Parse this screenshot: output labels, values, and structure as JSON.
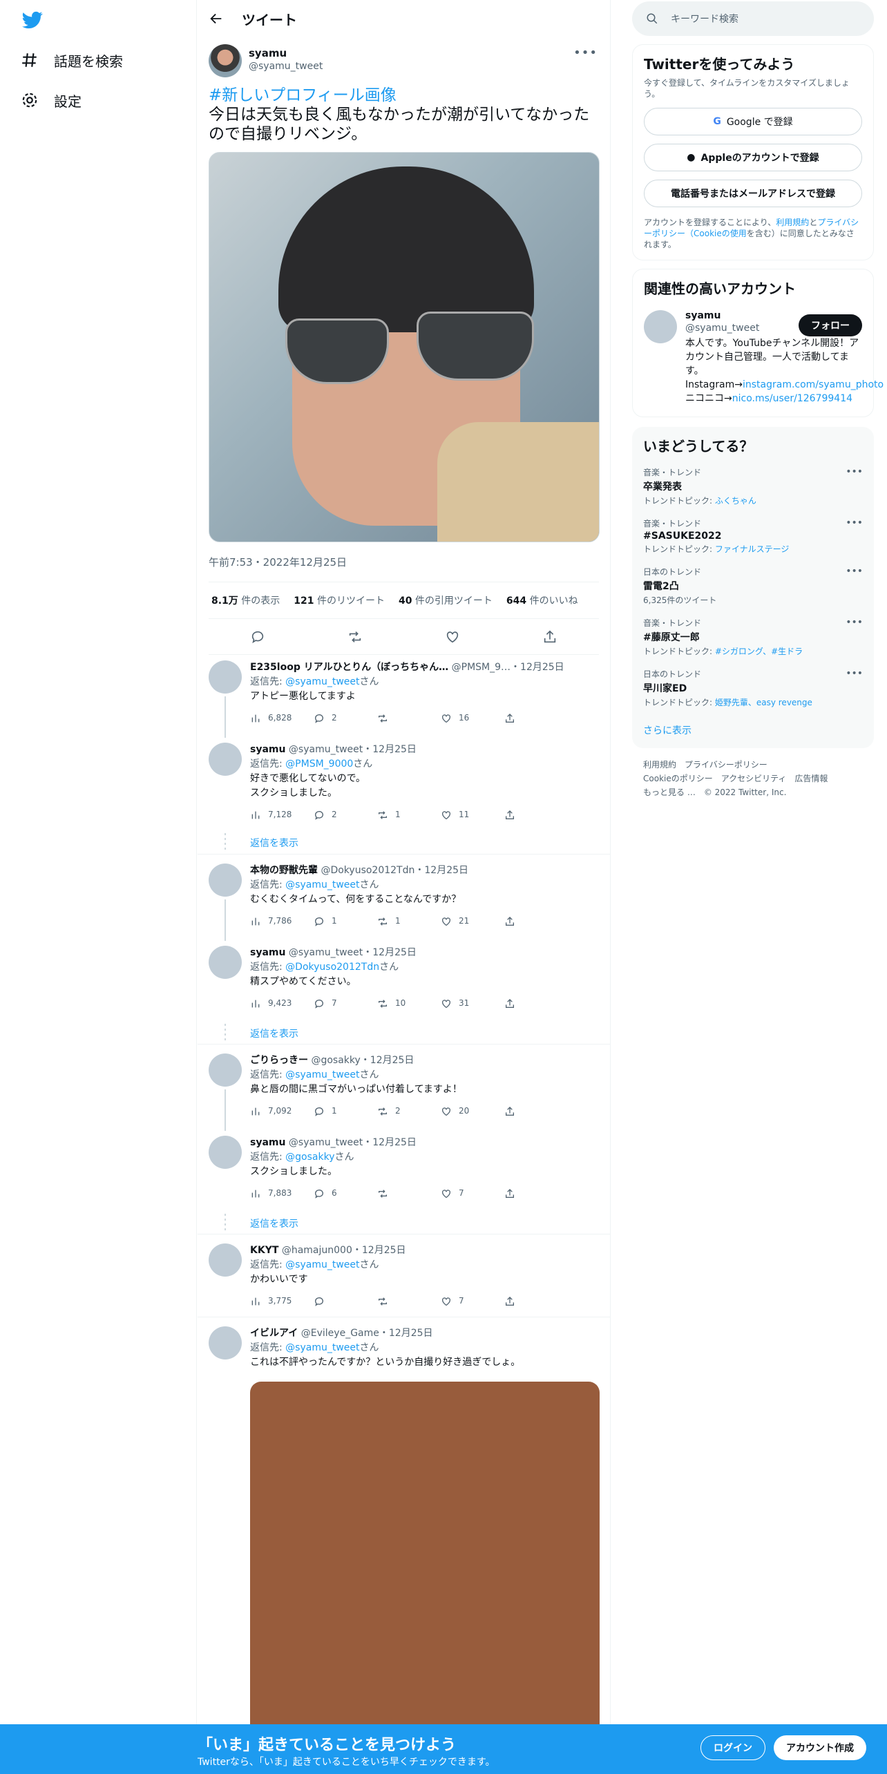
{
  "nav": {
    "items": [
      {
        "label": "話題を検索",
        "icon": "hashtag-icon"
      },
      {
        "label": "設定",
        "icon": "gear-icon"
      }
    ]
  },
  "header": {
    "title": "ツイート"
  },
  "tweet": {
    "name": "syamu",
    "handle": "@syamu_tweet",
    "hashtag": "#新しいプロフィール画像",
    "text": "今日は天気も良く風もなかったが潮が引いてなかったので自撮りリベンジ。",
    "time": "午前7:53・2022年12月25日",
    "stats": [
      {
        "num": "8.1万",
        "label": "件の表示"
      },
      {
        "num": "121",
        "label": "件のリツイート"
      },
      {
        "num": "40",
        "label": "件の引用ツイート"
      },
      {
        "num": "644",
        "label": "件のいいね"
      }
    ]
  },
  "replies": [
    {
      "name": "E235loop リアルひとりん（ぼっちちゃん…",
      "handle": "@PMSM_9…",
      "date": "・12月25日",
      "reply_to": "@syamu_tweet",
      "text": "アトピー悪化してますよ",
      "views": "6,828",
      "replies": "2",
      "retweets": "",
      "likes": "16"
    },
    {
      "name": "syamu",
      "handle": "@syamu_tweet",
      "date": "・12月25日",
      "reply_to": "@PMSM_9000",
      "text": "好きで悪化してないので。\nスクショしました。",
      "views": "7,128",
      "replies": "2",
      "retweets": "1",
      "likes": "11"
    },
    {
      "name": "本物の野獣先輩",
      "handle": "@Dokyuso2012Tdn",
      "date": "・12月25日",
      "reply_to": "@syamu_tweet",
      "text": "むくむくタイムって、何をすることなんですか？",
      "views": "7,786",
      "replies": "1",
      "retweets": "1",
      "likes": "21"
    },
    {
      "name": "syamu",
      "handle": "@syamu_tweet",
      "date": "・12月25日",
      "reply_to": "@Dokyuso2012Tdn",
      "text": "精スプやめてください。",
      "views": "9,423",
      "replies": "7",
      "retweets": "10",
      "likes": "31"
    },
    {
      "name": "ごりらっきー",
      "handle": "@gosakky",
      "date": "・12月25日",
      "reply_to": "@syamu_tweet",
      "text": "鼻と唇の間に黒ゴマがいっぱい付着してますよ！",
      "views": "7,092",
      "replies": "1",
      "retweets": "2",
      "likes": "20"
    },
    {
      "name": "syamu",
      "handle": "@syamu_tweet",
      "date": "・12月25日",
      "reply_to": "@gosakky",
      "text": "スクショしました。",
      "views": "7,883",
      "replies": "6",
      "retweets": "",
      "likes": "7"
    },
    {
      "name": "KKYT",
      "handle": "@hamajun000",
      "date": "・12月25日",
      "reply_to": "@syamu_tweet",
      "text": "かわいいです",
      "views": "3,775",
      "replies": "",
      "retweets": "",
      "likes": "7"
    },
    {
      "name": "イビルアイ",
      "handle": "@Evileye_Game",
      "date": "・12月25日",
      "reply_to": "@syamu_tweet",
      "text": "これは不評やったんですか？というか自撮り好き過ぎでしょ。",
      "views": "",
      "replies": "",
      "retweets": "",
      "likes": ""
    }
  ],
  "reply_prefix": "返信先: ",
  "reply_suffix": "さん",
  "show_replies": "返信を表示",
  "right": {
    "search_placeholder": "キーワード検索",
    "signup_title": "Twitterを使ってみよう",
    "signup_sub": "今すぐ登録して、タイムラインをカスタマイズしましょう。",
    "google": "Google で登録",
    "apple": "Appleのアカウントで登録",
    "phone": "電話番号またはメールアドレスで登録",
    "terms_1": "アカウントを登録することにより、",
    "terms_link1": "利用規約",
    "terms_2": "と",
    "terms_link2": "プライバシーポリシー（Cookieの使用",
    "terms_3": "を含む）に同意したとみなされます。",
    "related_title": "関連性の高いアカウント",
    "related_name": "syamu",
    "related_handle": "@syamu_tweet",
    "follow": "フォロー",
    "related_bio": "本人です。YouTubeチャンネル開設！アカウント自己管理。一人で活動してます。 Instagram→",
    "related_link1": "instagram.com/syamu_photo",
    "related_bio2": " ニコニコ→",
    "related_link2": "nico.ms/user/126799414",
    "trends_title": "いまどうしてる？",
    "trends": [
      {
        "cat": "音楽・トレンド",
        "name": "卒業発表",
        "topic_label": "トレンドトピック: ",
        "topic": "ふくちゃん"
      },
      {
        "cat": "音楽・トレンド",
        "name": "#SASUKE2022",
        "topic_label": "トレンドトピック: ",
        "topic": "ファイナルステージ"
      },
      {
        "cat": "日本のトレンド",
        "name": "雷電2凸",
        "topic_label": "6,325件のツイート",
        "topic": ""
      },
      {
        "cat": "音楽・トレンド",
        "name": "#藤原丈一郎",
        "topic_label": "トレンドトピック: ",
        "topic": "#シガロング、#生ドラ"
      },
      {
        "cat": "日本のトレンド",
        "name": "早川家ED",
        "topic_label": "トレンドトピック: ",
        "topic": "姫野先輩、easy revenge"
      }
    ],
    "show_more": "さらに表示",
    "footer1": "利用規約　プライバシーポリシー",
    "footer2": "Cookieのポリシー　アクセシビリティ　広告情報",
    "footer3": "もっと見る …　© 2022 Twitter, Inc."
  },
  "bottom": {
    "title": "「いま」起きていることを見つけよう",
    "sub": "Twitterなら、「いま」起きていることをいち早くチェックできます。",
    "login": "ログイン",
    "signup": "アカウント作成"
  },
  "colors": {
    "accent": "#1d9bf0",
    "bar": "#1d9bf0",
    "brown_image": "#985c3c"
  }
}
